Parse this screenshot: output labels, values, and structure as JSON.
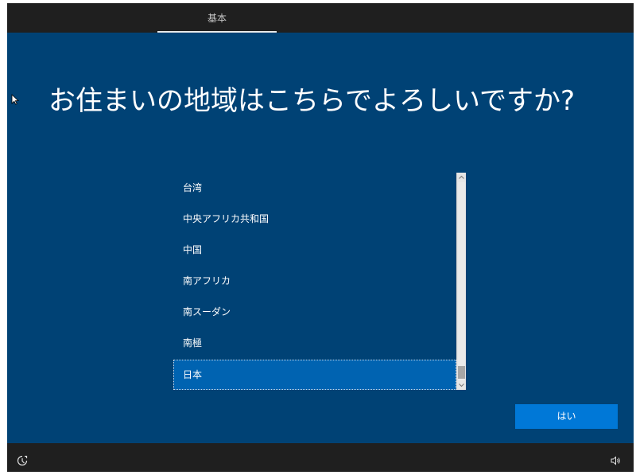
{
  "header": {
    "tab_label": "基本"
  },
  "main": {
    "heading": "お住まいの地域はこちらでよろしいですか?",
    "regions": [
      "台湾",
      "中央アフリカ共和国",
      "中国",
      "南アフリカ",
      "南スーダン",
      "南極",
      "日本"
    ],
    "selected_region": "日本",
    "confirm_label": "はい"
  },
  "icons": {
    "accessibility": "accessibility-icon",
    "volume": "volume-icon",
    "cursor": "mouse-cursor-icon",
    "scroll_up": "chevron-up-icon",
    "scroll_down": "chevron-down-icon"
  },
  "colors": {
    "background": "#004275",
    "selection": "#0063b1",
    "button": "#0078d7",
    "chrome": "#1f1f1f"
  }
}
